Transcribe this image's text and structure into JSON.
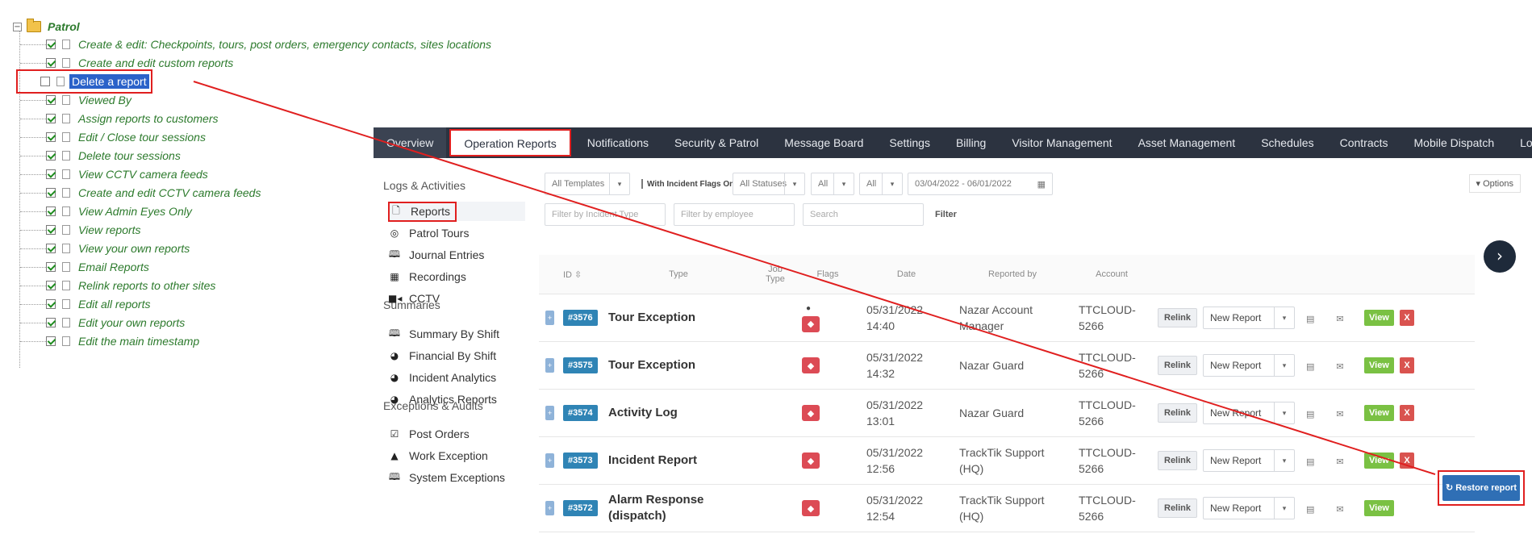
{
  "tree": {
    "root_label": "Patrol",
    "toggle_symbol": "−",
    "items": [
      {
        "label": "Create & edit: Checkpoints, tours, post orders, emergency contacts, sites locations",
        "checked": true
      },
      {
        "label": "Create and edit custom reports",
        "checked": true
      },
      {
        "label": "Delete a report",
        "checked": false,
        "selected": true
      },
      {
        "label": "Viewed By",
        "checked": true
      },
      {
        "label": "Assign reports to customers",
        "checked": true
      },
      {
        "label": "Edit / Close tour sessions",
        "checked": true
      },
      {
        "label": "Delete tour sessions",
        "checked": true
      },
      {
        "label": "View CCTV camera feeds",
        "checked": true
      },
      {
        "label": "Create and edit CCTV camera feeds",
        "checked": true
      },
      {
        "label": "View Admin Eyes Only",
        "checked": true
      },
      {
        "label": "View reports",
        "checked": true
      },
      {
        "label": "View your own reports",
        "checked": true
      },
      {
        "label": "Email Reports",
        "checked": true
      },
      {
        "label": "Relink reports to other sites",
        "checked": true
      },
      {
        "label": "Edit all reports",
        "checked": true
      },
      {
        "label": "Edit your own reports",
        "checked": true
      },
      {
        "label": "Edit the main timestamp",
        "checked": true
      }
    ]
  },
  "nav": {
    "tabs": [
      "Overview",
      "Operation Reports",
      "Notifications",
      "Security & Patrol",
      "Message Board",
      "Settings",
      "Billing",
      "Visitor Management",
      "Asset Management",
      "Schedules",
      "Contracts",
      "Mobile Dispatch",
      "Lone'"
    ],
    "active": "Operation Reports"
  },
  "sidebar": {
    "logs_heading": "Logs & Activities",
    "logs": [
      {
        "label": "Reports",
        "icon": "document-icon",
        "glyph": "🗋"
      },
      {
        "label": "Patrol Tours",
        "icon": "target-icon",
        "glyph": "◎"
      },
      {
        "label": "Journal Entries",
        "icon": "book-icon",
        "glyph": "🕮"
      },
      {
        "label": "Recordings",
        "icon": "film-icon",
        "glyph": "▦"
      },
      {
        "label": "CCTV",
        "icon": "camera-icon",
        "glyph": "■◂"
      }
    ],
    "summaries_heading": "Summaries",
    "summaries": [
      {
        "label": "Summary By Shift",
        "icon": "book-icon",
        "glyph": "🕮"
      },
      {
        "label": "Financial By Shift",
        "icon": "pie-chart-icon",
        "glyph": "◕"
      },
      {
        "label": "Incident Analytics",
        "icon": "pie-chart-icon",
        "glyph": "◕"
      },
      {
        "label": "Analytics Reports",
        "icon": "pie-chart-icon",
        "glyph": "◕"
      }
    ],
    "exceptions_heading": "Exceptions & Audits",
    "exceptions": [
      {
        "label": "Post Orders",
        "icon": "checkbox-icon",
        "glyph": "☑"
      },
      {
        "label": "Work Exception",
        "icon": "warning-icon",
        "glyph": "▲"
      },
      {
        "label": "System Exceptions",
        "icon": "book-icon",
        "glyph": "🕮"
      }
    ]
  },
  "filters": {
    "templates": "All Templates",
    "incident_flags_label": "With Incident Flags Only",
    "statuses": "All Statuses",
    "all1": "All",
    "all2": "All",
    "date_range": "03/04/2022 - 06/01/2022",
    "incident_type_placeholder": "Filter by Incident Type",
    "employee_placeholder": "Filter by employee",
    "search_placeholder": "Search",
    "filter_button": "Filter",
    "options": "▾ Options"
  },
  "table": {
    "headers": {
      "id": "ID ⇳",
      "type": "Type",
      "job_type": "Job Type",
      "flags": "Flags",
      "date": "Date",
      "reported_by": "Reported by",
      "account": "Account"
    },
    "rows": [
      {
        "id": "#3576",
        "type": "Tour Exception",
        "date": "05/31/2022",
        "time": "14:40",
        "reported_by": "Nazar Account Manager",
        "account": "TTCLOUD-5266",
        "pin": true
      },
      {
        "id": "#3575",
        "type": "Tour Exception",
        "date": "05/31/2022",
        "time": "14:32",
        "reported_by": "Nazar Guard",
        "account": "TTCLOUD-5266",
        "pin": false
      },
      {
        "id": "#3574",
        "type": "Activity Log",
        "date": "05/31/2022",
        "time": "13:01",
        "reported_by": "Nazar Guard",
        "account": "TTCLOUD-5266",
        "pin": false
      },
      {
        "id": "#3573",
        "type": "Incident Report",
        "date": "05/31/2022",
        "time": "12:56",
        "reported_by": "TrackTik Support (HQ)",
        "account": "TTCLOUD-5266",
        "pin": false
      },
      {
        "id": "#3572",
        "type": "Alarm Response (dispatch)",
        "date": "05/31/2022",
        "time": "12:54",
        "reported_by": "TrackTik Support (HQ)",
        "account": "TTCLOUD-5266",
        "pin": false
      }
    ],
    "relink_label": "Relink",
    "new_report_label": "New Report",
    "view_label": "View",
    "delete_label": "X",
    "restore_label": "↻ Restore report"
  },
  "colors": {
    "nav_bg": "#2c3340",
    "id_badge": "#2f84b5",
    "flag": "#dc4b55",
    "view": "#7ac143",
    "delete": "#d9534f",
    "annotation": "#e01f1f"
  }
}
